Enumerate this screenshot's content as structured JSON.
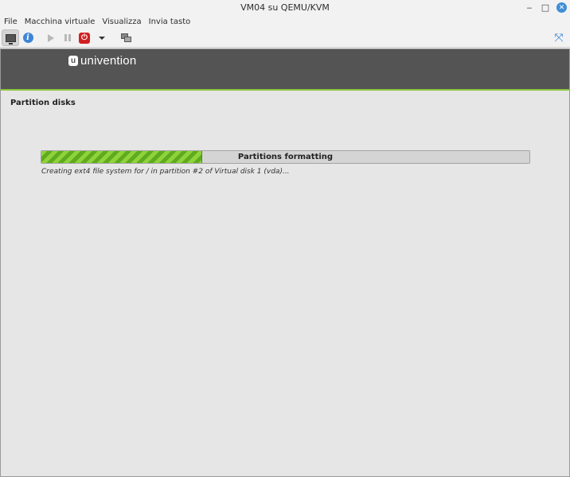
{
  "window": {
    "title": "VM04 su QEMU/KVM",
    "controls": {
      "minimize": "‒",
      "maximize": "□",
      "close": "✕"
    }
  },
  "menu": [
    "File",
    "Macchina virtuale",
    "Visualizza",
    "Invia tasto"
  ],
  "toolbar": {
    "icons": [
      "console-icon",
      "info-icon",
      "play-icon",
      "pause-icon",
      "power-icon",
      "dropdown-icon",
      "snapshot-icon",
      "fullscreen-icon"
    ],
    "info_glyph": "i",
    "power_glyph": "⏻",
    "fullscreen_glyph": "⤧"
  },
  "installer": {
    "logo_text": "univention",
    "logo_mark": "u",
    "heading": "Partition disks",
    "progress": {
      "label": "Partitions formatting",
      "fraction": 0.33
    },
    "status": "Creating ext4 file system for / in partition #2 of Virtual disk 1 (vda)..."
  },
  "colors": {
    "banner": "#545454",
    "accent_green": "#8cc63f",
    "info_blue": "#3d85d8",
    "power_red": "#d21f1f"
  }
}
